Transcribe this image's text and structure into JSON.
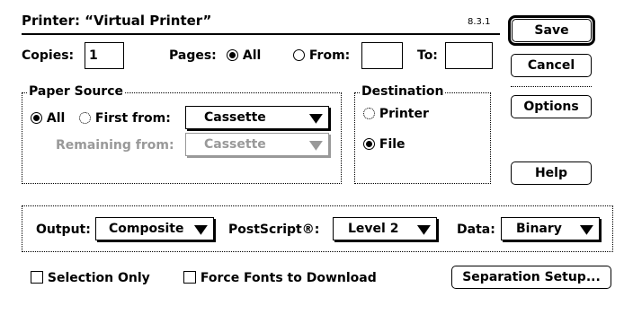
{
  "window": {
    "title": "Printer: “Virtual Printer”",
    "version": "8.3.1"
  },
  "buttons": {
    "save": "Save",
    "cancel": "Cancel",
    "options": "Options",
    "help": "Help",
    "separation_setup": "Separation Setup..."
  },
  "copies": {
    "label": "Copies:",
    "value": "1"
  },
  "pages": {
    "label": "Pages:",
    "all_label": "All",
    "all_selected": true,
    "from_label": "From:",
    "from_value": "",
    "to_label": "To:",
    "to_value": ""
  },
  "paper_source": {
    "title": "Paper Source",
    "all_label": "All",
    "all_selected": true,
    "first_from_label": "First from:",
    "first_from_value": "Cassette",
    "remaining_from_label": "Remaining from:",
    "remaining_from_value": "Cassette"
  },
  "destination": {
    "title": "Destination",
    "printer_label": "Printer",
    "file_label": "File",
    "selected": "File"
  },
  "output_options": {
    "output_label": "Output:",
    "output_value": "Composite",
    "postscript_label": "PostScript®:",
    "postscript_value": "Level 2",
    "data_label": "Data:",
    "data_value": "Binary"
  },
  "checkboxes": {
    "selection_only": {
      "label": "Selection Only",
      "checked": false
    },
    "force_fonts": {
      "label": "Force Fonts to Download",
      "checked": false
    }
  },
  "icons": {
    "popup_arrow": "▼"
  }
}
